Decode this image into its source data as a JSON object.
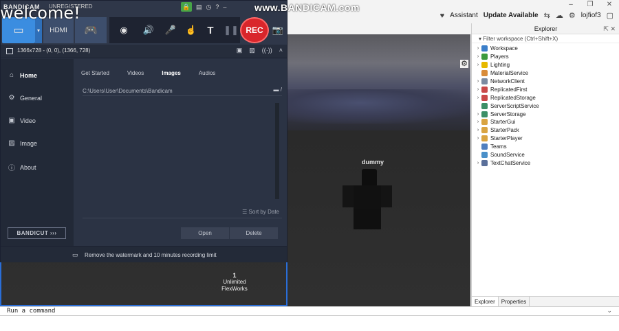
{
  "overlay": {
    "welcome": "welcome!",
    "watermark": "www.BANDICAM.com"
  },
  "studio": {
    "window_controls": [
      "–",
      "❐",
      "✕"
    ],
    "topbar_right": {
      "assistant": "Assistant",
      "update": "Update Available",
      "username": "lojfiof3"
    },
    "command_placeholder": "Run a command"
  },
  "viewport": {
    "player_name": "dummy",
    "center_number": "1",
    "center_line1": "Unlimited",
    "center_line2": "FlexWorks"
  },
  "explorer": {
    "title": "Explorer",
    "filter_placeholder": "Filter workspace (Ctrl+Shift+X)",
    "items": [
      {
        "label": "Workspace",
        "icon_color": "#3a7ec9",
        "expandable": true
      },
      {
        "label": "Players",
        "icon_color": "#3c9a3c",
        "expandable": true
      },
      {
        "label": "Lighting",
        "icon_color": "#e6b800",
        "expandable": true
      },
      {
        "label": "MaterialService",
        "icon_color": "#d98c3a",
        "expandable": false
      },
      {
        "label": "NetworkClient",
        "icon_color": "#7c8ba1",
        "expandable": true
      },
      {
        "label": "ReplicatedFirst",
        "icon_color": "#c94848",
        "expandable": true
      },
      {
        "label": "ReplicatedStorage",
        "icon_color": "#c94848",
        "expandable": true
      },
      {
        "label": "ServerScriptService",
        "icon_color": "#3c8f66",
        "expandable": false
      },
      {
        "label": "ServerStorage",
        "icon_color": "#3c8f66",
        "expandable": true
      },
      {
        "label": "StarterGui",
        "icon_color": "#d9a441",
        "expandable": true
      },
      {
        "label": "StarterPack",
        "icon_color": "#d9a441",
        "expandable": true
      },
      {
        "label": "StarterPlayer",
        "icon_color": "#d9a441",
        "expandable": true
      },
      {
        "label": "Teams",
        "icon_color": "#4f7fbf",
        "expandable": false
      },
      {
        "label": "SoundService",
        "icon_color": "#4a90c9",
        "expandable": false
      },
      {
        "label": "TextChatService",
        "icon_color": "#5a6f9a",
        "expandable": true
      }
    ],
    "tabs": [
      "Explorer",
      "Properties"
    ]
  },
  "bandicam": {
    "brand": "BANDICAM",
    "unregistered": "UNREGISTERED",
    "rec_label": "REC",
    "text_tool": "T",
    "hdmi": "HDMI",
    "capture_area": "1366x728 - (0, 0), (1366, 728)",
    "sidebar": [
      {
        "label": "Home",
        "icon": "home-icon",
        "glyph": "⌂",
        "active": true
      },
      {
        "label": "General",
        "icon": "gear-icon",
        "glyph": "⚙",
        "active": false
      },
      {
        "label": "Video",
        "icon": "video-icon",
        "glyph": "▣",
        "active": false
      },
      {
        "label": "Image",
        "icon": "image-icon",
        "glyph": "▨",
        "active": false
      },
      {
        "label": "About",
        "icon": "info-icon",
        "glyph": "ⓘ",
        "active": false
      }
    ],
    "bandicut": "BANDICUT ›››",
    "tabs": [
      "Get Started",
      "Videos",
      "Images",
      "Audios"
    ],
    "active_tab": "Images",
    "folder_path": "C:\\Users\\User\\Documents\\Bandicam",
    "sort_label": "Sort by Date",
    "open_button": "Open",
    "delete_button": "Delete",
    "footer_text": "Remove the watermark and 10 minutes recording limit"
  }
}
